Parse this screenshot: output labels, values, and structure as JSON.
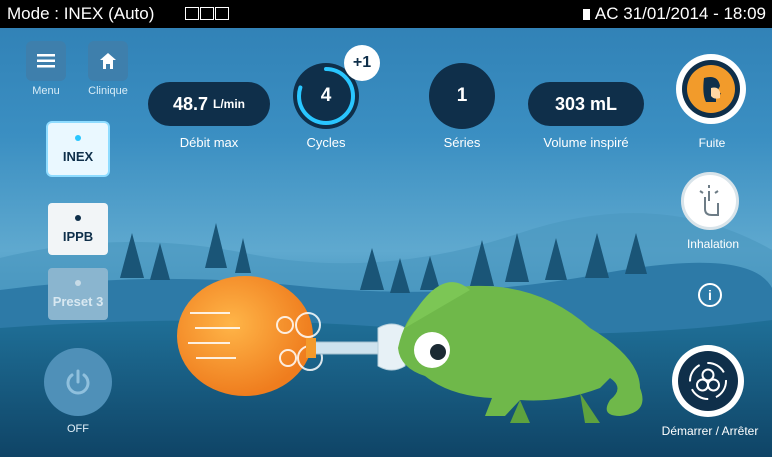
{
  "status": {
    "mode": "Mode : INEX (Auto)",
    "power": "AC",
    "datetime": "31/01/2014 - 18:09"
  },
  "nav": {
    "menu_label": "Menu",
    "home_label": "Clinique"
  },
  "metrics": {
    "flow": {
      "value": "48.7",
      "unit": "L/min",
      "label": "Débit max"
    },
    "cycles": {
      "value": "4",
      "badge": "+1",
      "label": "Cycles",
      "progress": 0.8
    },
    "series": {
      "value": "1",
      "label": "Séries"
    },
    "volume": {
      "value": "303 mL",
      "label": "Volume inspiré"
    }
  },
  "modes": [
    {
      "label": "INEX",
      "state": "selected"
    },
    {
      "label": "IPPB",
      "state": "available"
    },
    {
      "label": "Preset 3",
      "state": "disabled"
    }
  ],
  "power_button": {
    "label": "OFF"
  },
  "right_panel": {
    "leak_label": "Fuite",
    "inhalation_label": "Inhalation",
    "start_stop_label": "Démarrer / Arrêter"
  },
  "colors": {
    "statusbar": "#000000",
    "pill": "#0f2f4a",
    "accent_cyan": "#29c6ff",
    "leak_orange": "#f29b2b",
    "chameleon_green": "#6fb84a",
    "balloon_orange": "#f3922b"
  }
}
